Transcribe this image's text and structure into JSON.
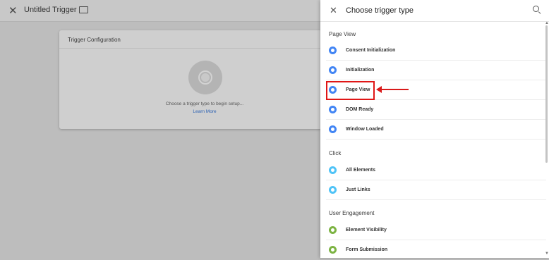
{
  "topbar": {
    "title": "Untitled Trigger"
  },
  "card": {
    "header": "Trigger Configuration",
    "hint": "Choose a trigger type to begin setup...",
    "learn_more": "Learn More"
  },
  "panel": {
    "title": "Choose trigger type",
    "sections": [
      {
        "label": "Page View"
      },
      {
        "label": "Click"
      },
      {
        "label": "User Engagement"
      }
    ],
    "items": [
      {
        "label": "Consent Initialization",
        "color": "#4285f4"
      },
      {
        "label": "Initialization",
        "color": "#4285f4"
      },
      {
        "label": "Page View",
        "color": "#4285f4"
      },
      {
        "label": "DOM Ready",
        "color": "#4285f4"
      },
      {
        "label": "Window Loaded",
        "color": "#4285f4"
      },
      {
        "label": "All Elements",
        "color": "#4fc3f7"
      },
      {
        "label": "Just Links",
        "color": "#4fc3f7"
      },
      {
        "label": "Element Visibility",
        "color": "#7cb342"
      },
      {
        "label": "Form Submission",
        "color": "#7cb342"
      }
    ]
  }
}
